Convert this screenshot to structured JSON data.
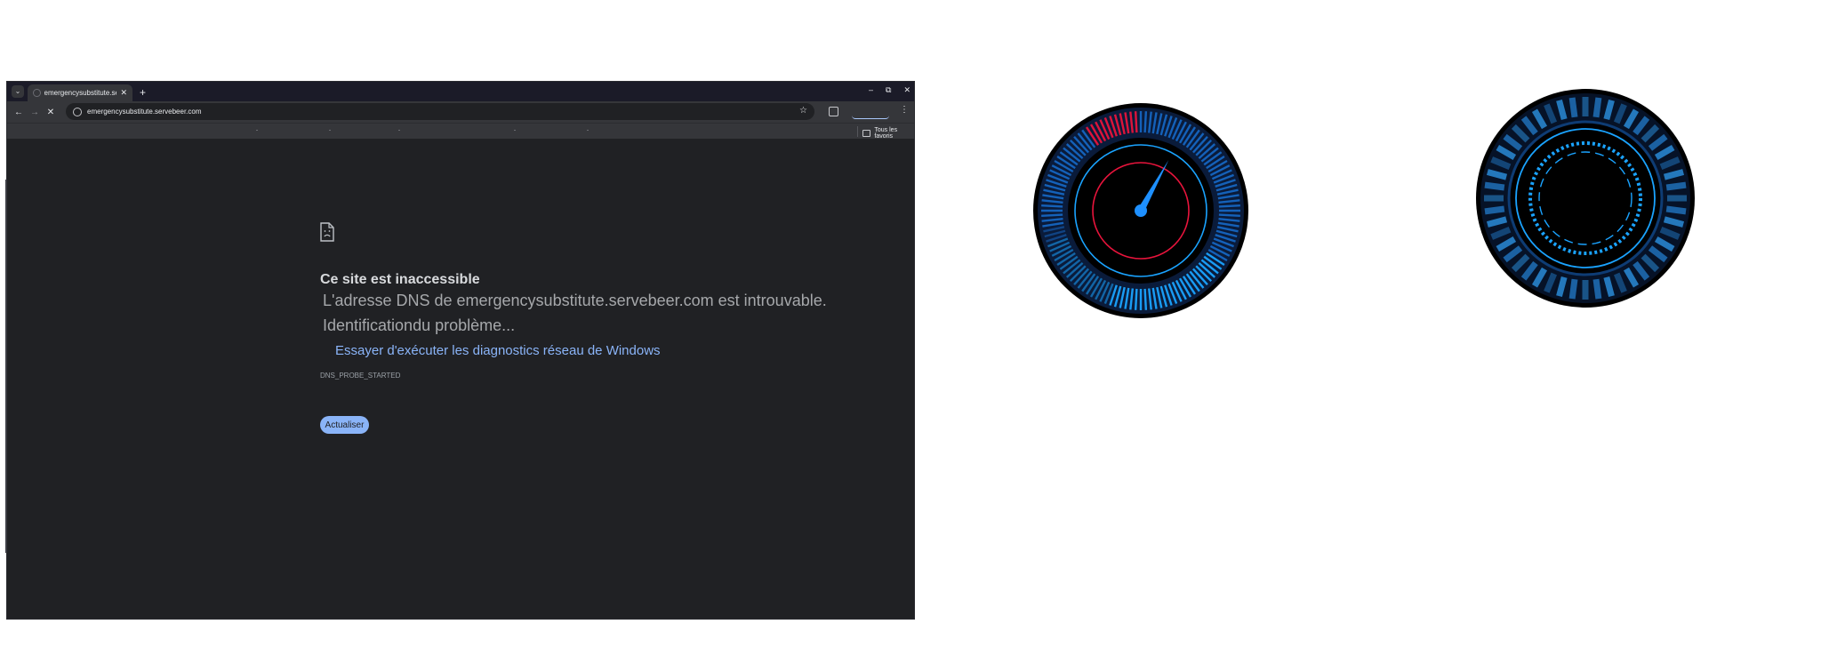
{
  "browser": {
    "tab": {
      "title": "emergencysubstitute.servebeer.com"
    },
    "new_tab_symbol": "+",
    "window_controls": {
      "minimize": "–",
      "restore": "⧉",
      "close": "✕"
    },
    "toolbar": {
      "back": "←",
      "forward": "→",
      "stop": "✕",
      "url": "emergencysubstitute.servebeer.com",
      "star": "☆",
      "menu": "⋮"
    },
    "bookmarks_bar": {
      "all_bookmarks_label": "Tous les favoris"
    }
  },
  "error_page": {
    "title": "Ce site est inaccessible",
    "line1": "L'adresse DNS de emergencysubstitute.servebeer.com est introuvable.",
    "line2": "Identificationdu problème...",
    "diagnostics_link": "Essayer d'exécuter les diagnostics réseau de Windows",
    "error_code": "DNS_PROBE_STARTED",
    "reload_button": "Actualiser"
  },
  "gauges": {
    "speedometer": {
      "icon": "speedometer-icon",
      "needle_fraction": 0.08,
      "colors": {
        "accent": "#1e90ff",
        "alert": "#e8143c",
        "ring": "#000000"
      }
    },
    "loading_ring": {
      "icon": "loading-ring-icon",
      "colors": {
        "accent": "#1aa3ff",
        "dark": "#08152a"
      }
    }
  }
}
